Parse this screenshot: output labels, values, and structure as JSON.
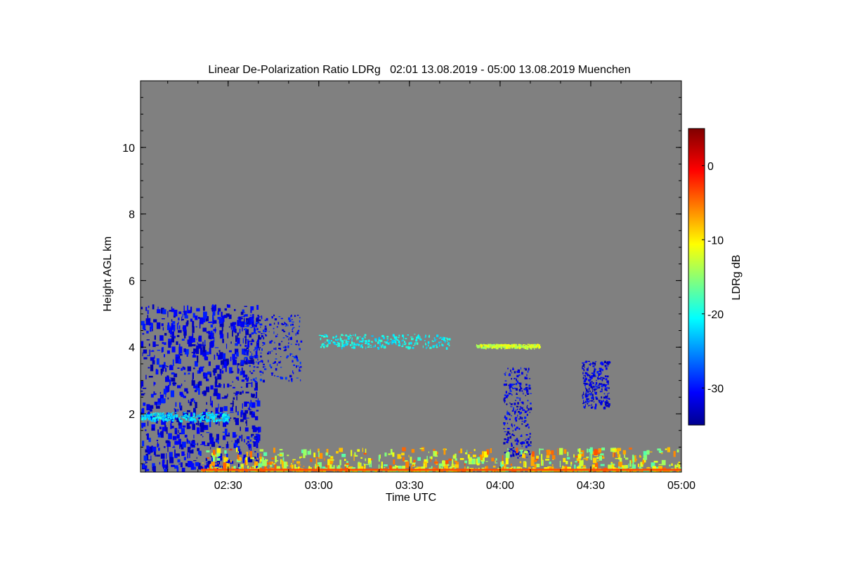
{
  "chart_data": {
    "type": "heatmap",
    "title": "Linear De-Polarization Ratio LDRg   02:01 13.08.2019 - 05:00 13.08.2019 Muenchen",
    "xlabel": "Time UTC",
    "ylabel": "Height AGL km",
    "xlim": [
      "02:01",
      "05:00"
    ],
    "xticks": [
      "02:30",
      "03:00",
      "03:30",
      "04:00",
      "04:30",
      "05:00"
    ],
    "ylim": [
      0.25,
      12
    ],
    "yticks": [
      2,
      4,
      6,
      8,
      10
    ],
    "background_color": "#808080",
    "colorbar": {
      "label": "LDRg dB",
      "range": [
        -35,
        5
      ],
      "ticks": [
        0,
        -10,
        -20,
        -30
      ],
      "colormap": "jet"
    },
    "features": [
      {
        "name": "low cloud and precipitation",
        "t_start": "02:01",
        "t_end": "02:40",
        "h_min": 0.3,
        "h_max": 5.3,
        "ldr_db": -31
      },
      {
        "name": "melting layer band",
        "t_start": "02:01",
        "t_end": "02:30",
        "h_min": 1.8,
        "h_max": 2.05,
        "ldr_db": -21
      },
      {
        "name": "upper fall streaks",
        "t_start": "02:35",
        "t_end": "02:54",
        "h_min": 3.0,
        "h_max": 5.0,
        "ldr_db": -30
      },
      {
        "name": "aerosol layer",
        "t_start": "03:00",
        "t_end": "03:43",
        "h_min": 4.0,
        "h_max": 4.4,
        "ldr_db": -20
      },
      {
        "name": "aerosol layer",
        "t_start": "03:52",
        "t_end": "04:13",
        "h_min": 4.0,
        "h_max": 4.1,
        "ldr_db": -12
      },
      {
        "name": "virga",
        "t_start": "04:01",
        "t_end": "04:10",
        "h_min": 0.7,
        "h_max": 3.4,
        "ldr_db": -31
      },
      {
        "name": "virga",
        "t_start": "04:27",
        "t_end": "04:36",
        "h_min": 2.2,
        "h_max": 3.6,
        "ldr_db": -31
      },
      {
        "name": "near-ground clutter",
        "t_start": "02:21",
        "t_end": "05:00",
        "h_min": 0.3,
        "h_max": 1.0,
        "ldr_db": -10
      }
    ]
  }
}
